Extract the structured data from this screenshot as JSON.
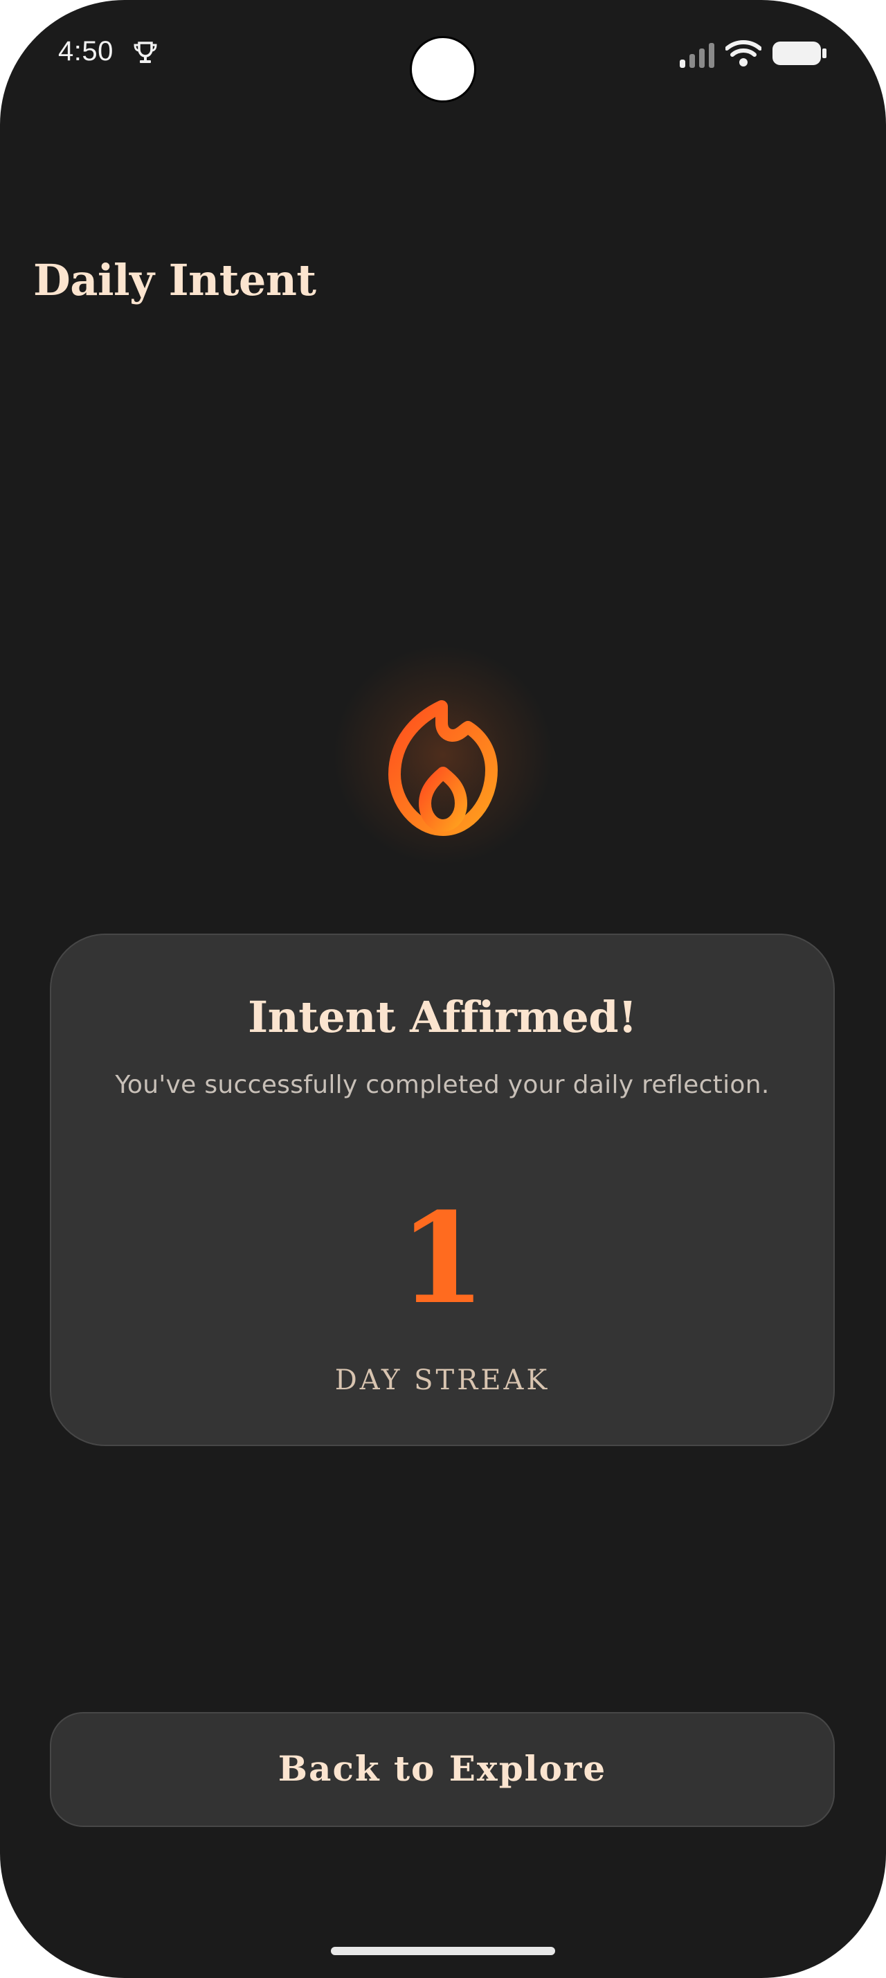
{
  "status_bar": {
    "time": "4:50",
    "icons": [
      "trophy-icon",
      "signal-icon",
      "wifi-icon",
      "battery-icon"
    ]
  },
  "app": {
    "title": "Daily Intent"
  },
  "hero": {
    "icon": "flame-icon",
    "gradient_start": "#ff5a1f",
    "gradient_end": "#ffa01e"
  },
  "card": {
    "title": "Intent Affirmed!",
    "subtitle": "You've successfully completed your daily reflection.",
    "streak_value": "1",
    "streak_label": "DAY STREAK"
  },
  "actions": {
    "back_label": "Back to Explore"
  },
  "colors": {
    "background": "#1b1b1b",
    "card": "#343434",
    "accent": "#ff6b1f",
    "heading": "#fbe4cf"
  }
}
